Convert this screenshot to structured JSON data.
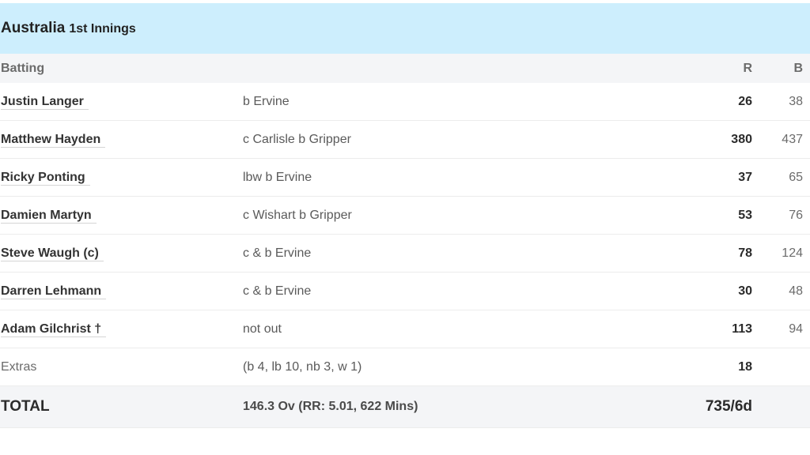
{
  "innings": {
    "team": "Australia",
    "label": "1st Innings"
  },
  "columns": {
    "batting": "Batting",
    "runs": "R",
    "balls": "B"
  },
  "batters": [
    {
      "name": "Justin Langer",
      "dismissal": "b Ervine",
      "runs": "26",
      "balls": "38"
    },
    {
      "name": "Matthew Hayden",
      "dismissal": "c Carlisle b Gripper",
      "runs": "380",
      "balls": "437"
    },
    {
      "name": "Ricky Ponting",
      "dismissal": "lbw b Ervine",
      "runs": "37",
      "balls": "65"
    },
    {
      "name": "Damien Martyn",
      "dismissal": "c Wishart b Gripper",
      "runs": "53",
      "balls": "76"
    },
    {
      "name": "Steve Waugh (c)",
      "dismissal": "c & b Ervine",
      "runs": "78",
      "balls": "124"
    },
    {
      "name": "Darren Lehmann",
      "dismissal": "c & b Ervine",
      "runs": "30",
      "balls": "48"
    },
    {
      "name": "Adam Gilchrist †",
      "dismissal": "not out",
      "runs": "113",
      "balls": "94"
    }
  ],
  "extras": {
    "label": "Extras",
    "detail": "(b 4, lb 10, nb 3, w 1)",
    "runs": "18"
  },
  "total": {
    "label": "TOTAL",
    "detail": "146.3 Ov (RR: 5.01, 622 Mins)",
    "score": "735/6d"
  }
}
